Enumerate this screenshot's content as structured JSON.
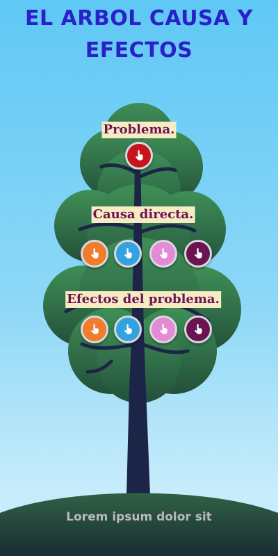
{
  "title": "EL ARBOL CAUSA Y EFECTOS",
  "sections": {
    "problem": {
      "label": "Problema."
    },
    "causes": {
      "label": "Causa directa."
    },
    "effects": {
      "label": "Efectos del problema."
    }
  },
  "footer": {
    "text": "Lorem ipsum dolor sit"
  },
  "colors": {
    "title": "#2a21c8",
    "label_bg": "#f6ebc2",
    "label_text": "#6b1452",
    "problem_button": "#c4161c",
    "orange_button": "#f07c2e",
    "blue_button": "#33a3e0",
    "pink_button": "#e58ad6",
    "purple_button": "#6b1452"
  },
  "icon": "hand-pointer-icon"
}
